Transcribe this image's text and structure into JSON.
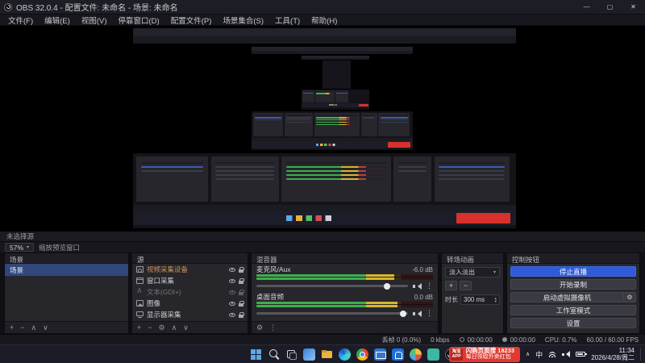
{
  "titlebar": {
    "title": "OBS 32.0.4 - 配置文件: 未命名 - 场景: 未命名",
    "minimize": "—",
    "maximize": "▢",
    "close": "✕"
  },
  "menubar": {
    "items": [
      "文件(F)",
      "编辑(E)",
      "视图(V)",
      "停靠窗口(D)",
      "配置文件(P)",
      "场景集合(S)",
      "工具(T)",
      "帮助(H)"
    ]
  },
  "preview_toolbar": {
    "no_source_label": "未选择源",
    "zoom_value": "57%",
    "fit_label": "缩放预览窗口"
  },
  "scenes": {
    "title": "场景",
    "items": [
      {
        "name": "场景"
      }
    ]
  },
  "sources": {
    "title": "源",
    "items": [
      {
        "name": "视频采集设备",
        "style": "color:#c9925f"
      },
      {
        "name": "窗口采集",
        "style": ""
      },
      {
        "name": "文本(GDI+)",
        "style": "opacity:0.45"
      },
      {
        "name": "图像",
        "style": ""
      },
      {
        "name": "显示器采集",
        "style": ""
      }
    ]
  },
  "mixer": {
    "title": "混音器",
    "channels": [
      {
        "name": "麦克风/Aux",
        "db": "-6.0 dB",
        "style": "--lv:78%;--fd:86%"
      },
      {
        "name": "桌面音频",
        "db": "0.0 dB",
        "style": "--lv:80%;--fd:97%"
      }
    ]
  },
  "transitions": {
    "title": "转场动画",
    "current": "淡入淡出",
    "duration_label": "时长",
    "duration_value": "300 ms"
  },
  "controls": {
    "title": "控制按钮",
    "stream_button": "停止直播",
    "record_button": "开始录制",
    "virtualcam_button": "启动虚拟摄像机",
    "studio_button": "工作室模式",
    "settings_button": "设置"
  },
  "statusbar": {
    "dropped_frames": "丢帧 0 (0.0%)",
    "bitrate": "0 kbps",
    "stream_time": "00:00:00",
    "record_time": "00:00:00",
    "cpu": "CPU: 0.7%",
    "fps": "60.00 / 60.00 FPS"
  },
  "taskbar": {
    "language": "中",
    "time": "11:34",
    "date": "2026/4/28/周二",
    "ad": {
      "logo_line1": "淘宝",
      "logo_line2": "APP",
      "line1": "闪购页面搜 18233",
      "line2": "每日领取外卖红包"
    }
  },
  "icons": {
    "add": "+",
    "remove": "−",
    "up": "∧",
    "down": "∨",
    "gear": "⚙",
    "kebab": "⋮",
    "caret": "▾",
    "caret_up": "▴"
  }
}
